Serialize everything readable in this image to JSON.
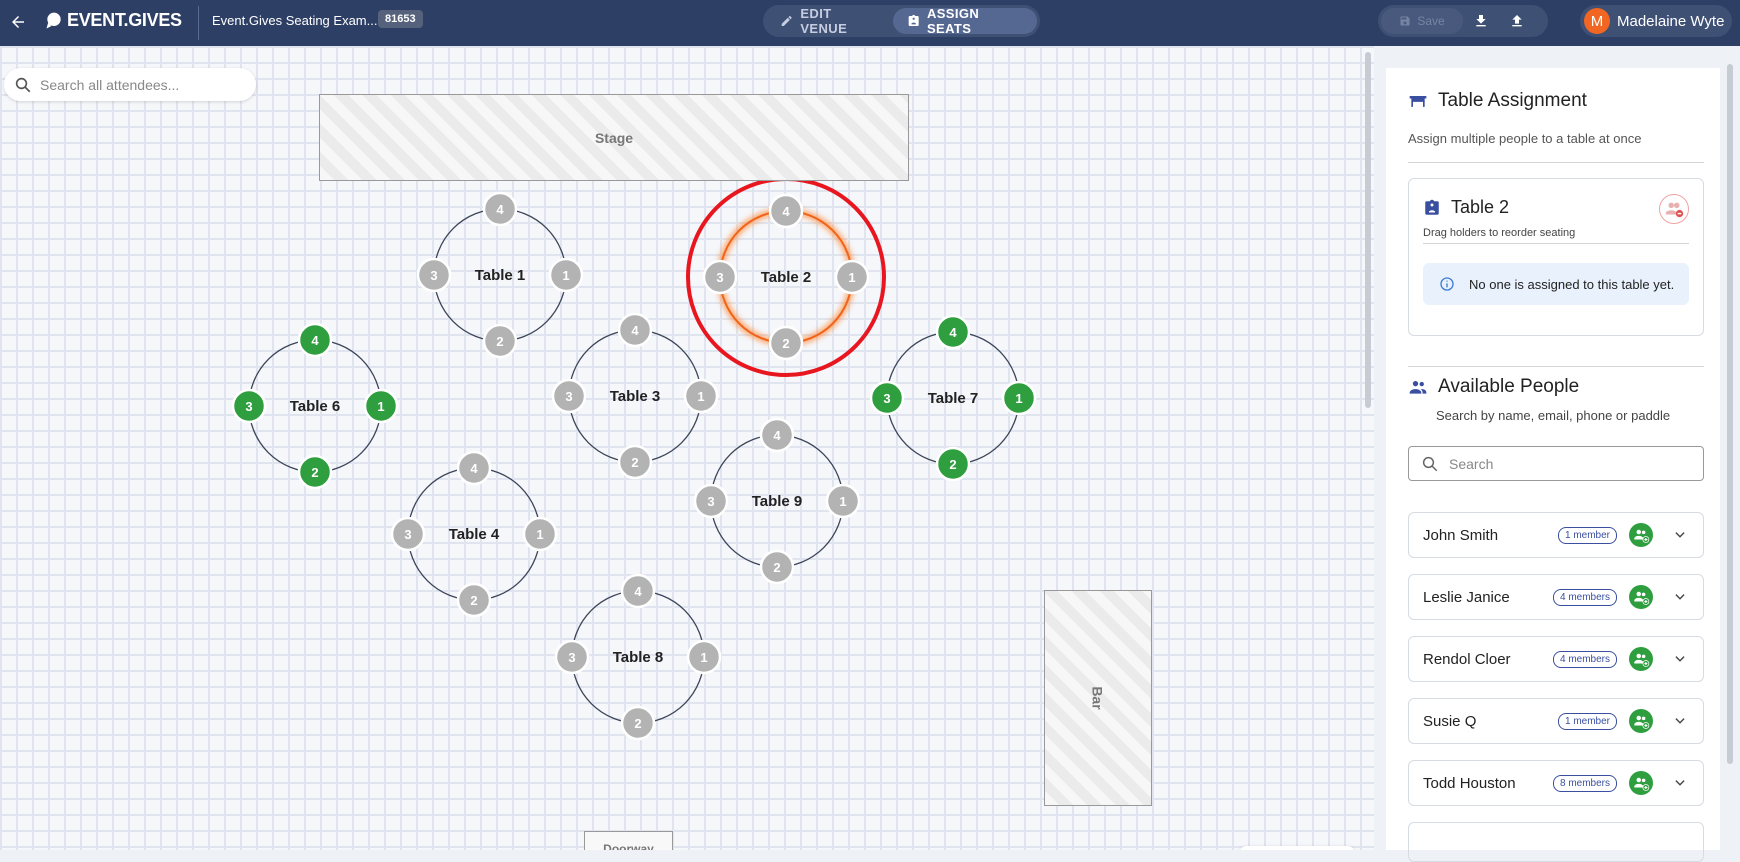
{
  "header": {
    "logo_text": "EVENT.GIVES",
    "event_title": "Event.Gives Seating Exam...",
    "event_id": "81653",
    "modes": [
      {
        "label": "EDIT VENUE",
        "active": false
      },
      {
        "label": "ASSIGN SEATS",
        "active": true
      }
    ],
    "save_label": "Save",
    "user_initial": "M",
    "user_name": "Madelaine Wyte"
  },
  "canvas": {
    "search_placeholder": "Search all attendees...",
    "zones": {
      "stage": "Stage",
      "bar": "Bar",
      "doorway": "Doorway"
    },
    "seat_colors": {
      "empty": "#b3b3b3",
      "filled": "#2e9e3e"
    },
    "selected_color": "#e8161f",
    "tables": [
      {
        "label": "Table 1",
        "seats": [
          "4",
          "1",
          "2",
          "3"
        ],
        "filled": false,
        "selected": false
      },
      {
        "label": "Table 2",
        "seats": [
          "4",
          "1",
          "2",
          "3"
        ],
        "filled": false,
        "selected": true
      },
      {
        "label": "Table 3",
        "seats": [
          "4",
          "1",
          "2",
          "3"
        ],
        "filled": false,
        "selected": false
      },
      {
        "label": "Table 4",
        "seats": [
          "4",
          "1",
          "2",
          "3"
        ],
        "filled": false,
        "selected": false
      },
      {
        "label": "Table 6",
        "seats": [
          "4",
          "1",
          "2",
          "3"
        ],
        "filled": true,
        "selected": false
      },
      {
        "label": "Table 7",
        "seats": [
          "4",
          "1",
          "2",
          "3"
        ],
        "filled": true,
        "selected": false
      },
      {
        "label": "Table 8",
        "seats": [
          "4",
          "1",
          "2",
          "3"
        ],
        "filled": false,
        "selected": false
      },
      {
        "label": "Table 9",
        "seats": [
          "4",
          "1",
          "2",
          "3"
        ],
        "filled": false,
        "selected": false
      }
    ]
  },
  "panel": {
    "title": "Table Assignment",
    "subtitle": "Assign multiple people to a table at once",
    "selected_table": {
      "name": "Table 2",
      "hint": "Drag holders to reorder seating",
      "empty_message": "No one is assigned to this table yet."
    },
    "available": {
      "title": "Available People",
      "subtitle": "Search by name, email, phone or paddle",
      "search_placeholder": "Search",
      "people": [
        {
          "name": "John Smith",
          "members": "1 member"
        },
        {
          "name": "Leslie Janice",
          "members": "4 members"
        },
        {
          "name": "Rendol Cloer",
          "members": "4 members"
        },
        {
          "name": "Susie Q",
          "members": "1 member"
        },
        {
          "name": "Todd Houston",
          "members": "8 members"
        }
      ]
    }
  }
}
